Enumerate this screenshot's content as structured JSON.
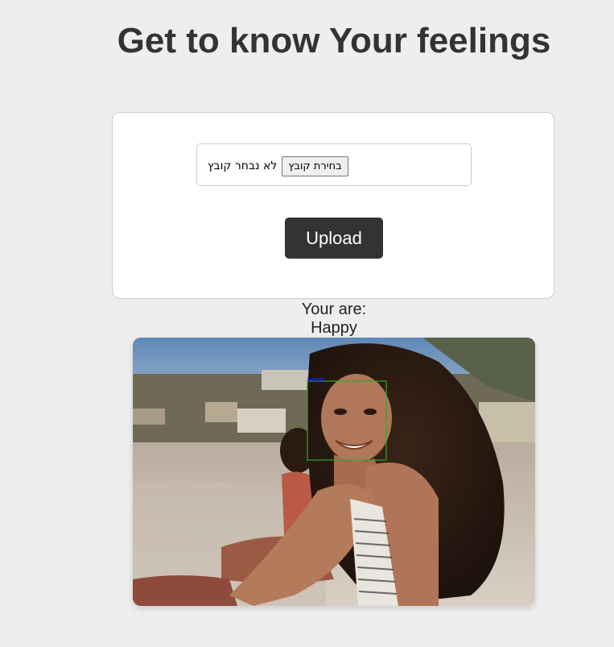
{
  "header": {
    "title": "Get to know Your feelings"
  },
  "upload_form": {
    "file_button_label": "בחירת קובץ",
    "file_status": "לא נבחר קובץ",
    "upload_label": "Upload"
  },
  "result": {
    "prefix": "Your are:",
    "emotion": "Happy"
  },
  "photo": {
    "detection_label": "Happy"
  },
  "colors": {
    "background": "#eeeeee",
    "card": "#ffffff",
    "button": "#333333",
    "detection_box": "#2eaa2e",
    "detection_label": "#1a1aff"
  }
}
